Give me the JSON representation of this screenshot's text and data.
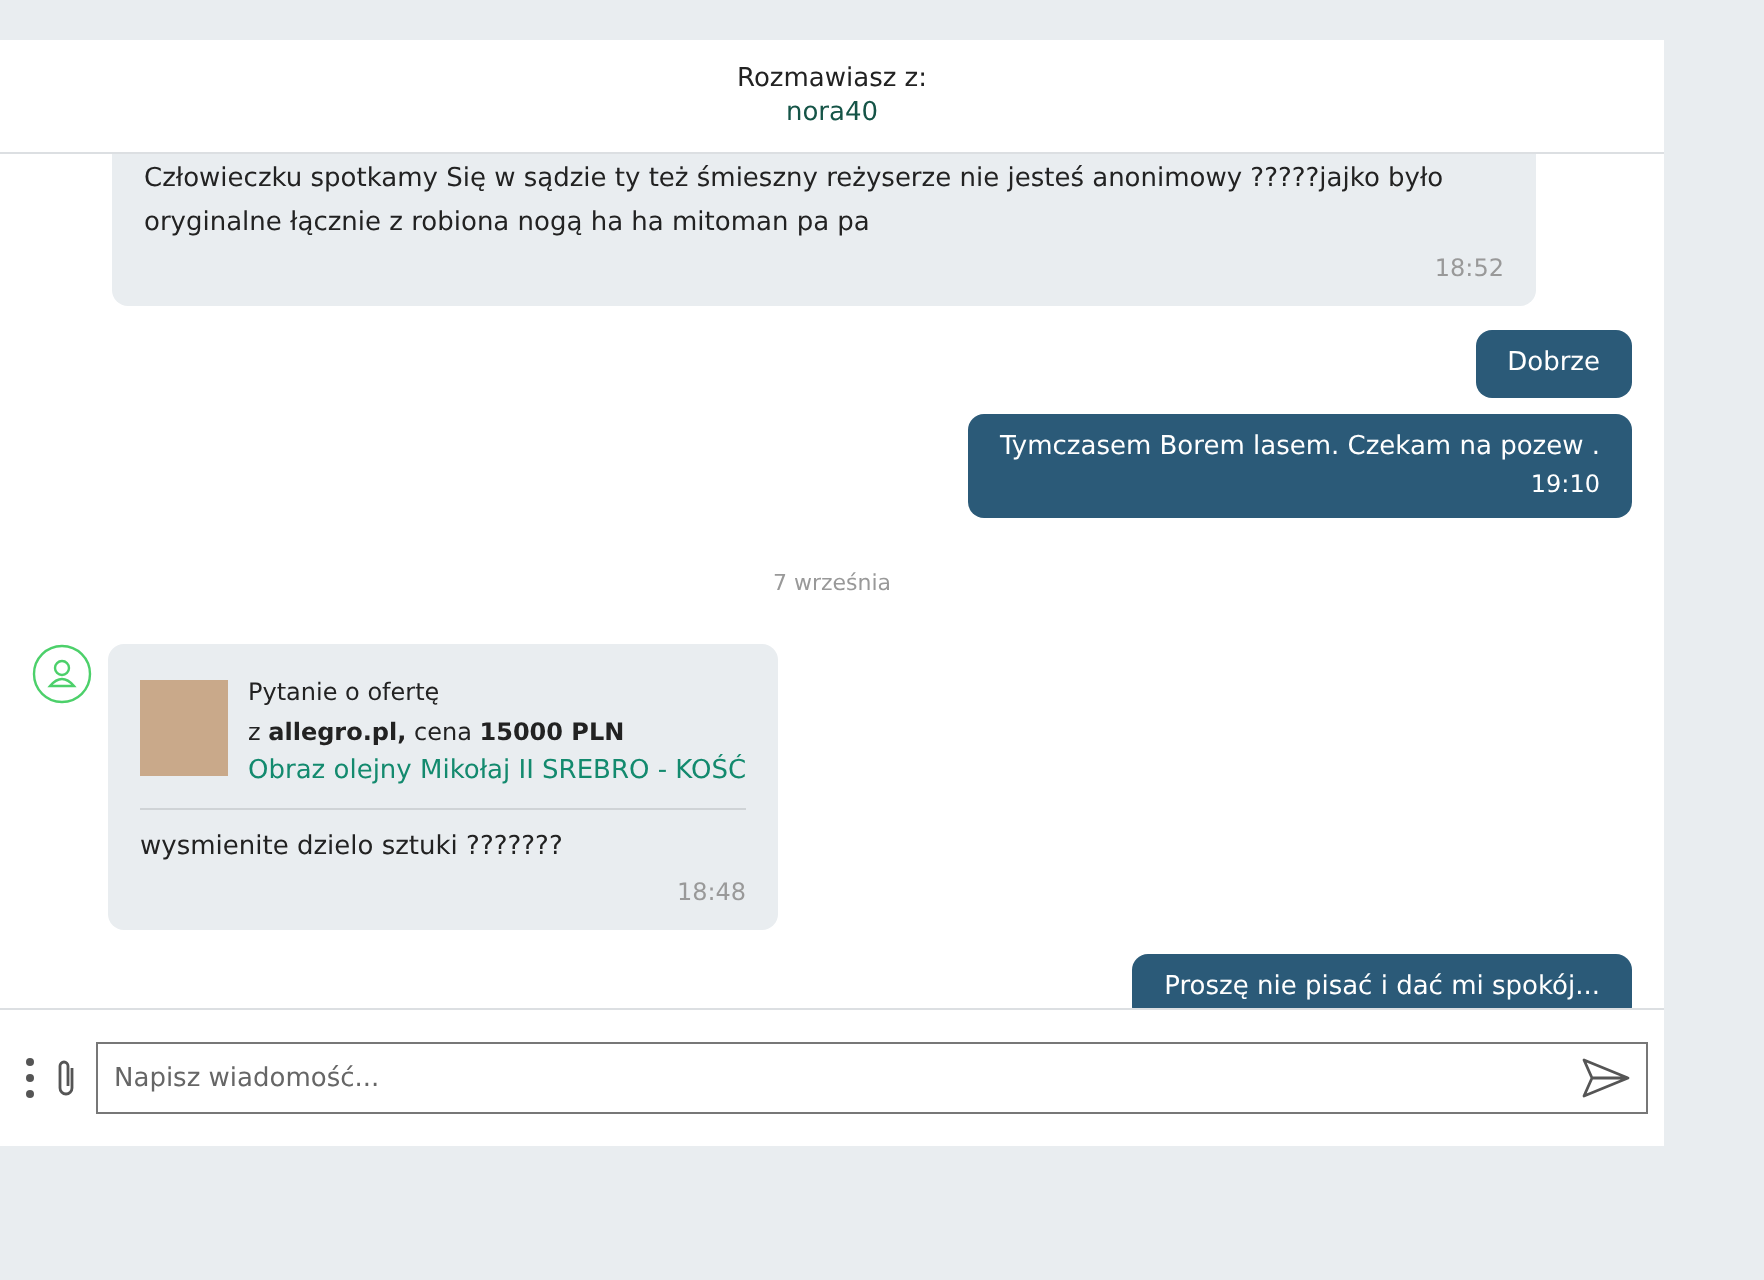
{
  "header": {
    "label": "Rozmawiasz z:",
    "user": "nora40"
  },
  "messages": [
    {
      "kind": "incoming",
      "text": "Człowieczku spotkamy Się w sądzie ty też śmieszny reżyserze nie jesteś anonimowy ?????jajko było oryginalne łącznie z robiona nogą ha ha mitoman pa pa",
      "time": "18:52"
    },
    {
      "kind": "outgoing",
      "text": "Dobrze"
    },
    {
      "kind": "outgoing",
      "text": "Tymczasem Borem lasem. Czekam na pozew .",
      "time": "19:10"
    },
    {
      "kind": "date",
      "text": "7 września"
    },
    {
      "kind": "offer",
      "title": "Pytanie o ofertę",
      "source": "z **allegro.pl,** cena **15000 PLN**",
      "link": "Obraz olejny Mikołaj II SREBRO - KOŚĆ",
      "text": "wysmienite dzielo sztuki ???????",
      "time": "18:48"
    },
    {
      "kind": "outgoing",
      "text": "Proszę nie pisać i dać mi spokój..."
    }
  ],
  "composer": {
    "placeholder": "Napisz wiadomość..."
  }
}
